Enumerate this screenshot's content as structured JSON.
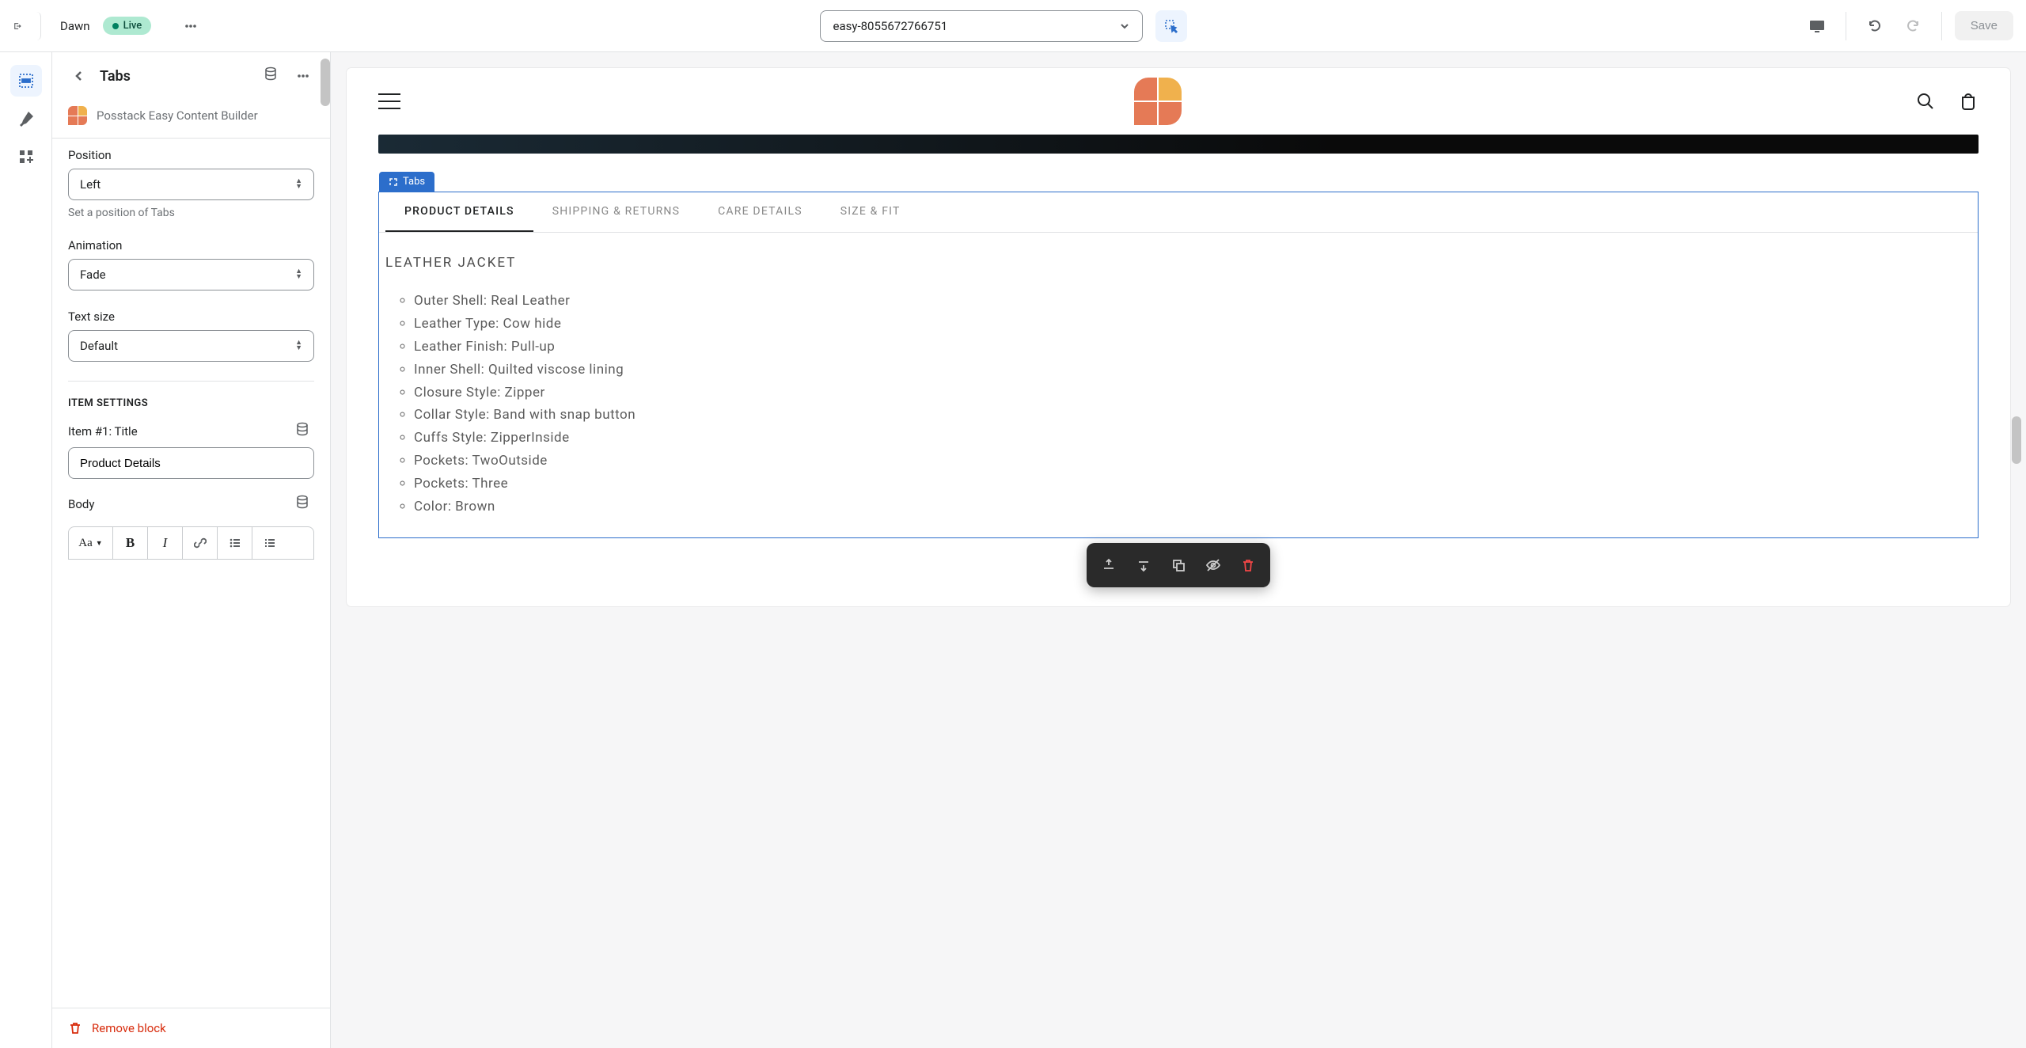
{
  "topbar": {
    "theme_name": "Dawn",
    "live_label": "Live",
    "page_select_value": "easy-8055672766751",
    "save_label": "Save"
  },
  "sidebar": {
    "title": "Tabs",
    "app_name": "Posstack Easy Content Builder",
    "position": {
      "label": "Position",
      "value": "Left",
      "help": "Set a position of Tabs"
    },
    "animation": {
      "label": "Animation",
      "value": "Fade"
    },
    "text_size": {
      "label": "Text size",
      "value": "Default"
    },
    "item_settings_heading": "ITEM SETTINGS",
    "item1_title": {
      "label": "Item #1: Title",
      "value": "Product Details"
    },
    "body_label": "Body",
    "remove_label": "Remove block"
  },
  "preview": {
    "tabs_block_label": "Tabs",
    "tabs": [
      "PRODUCT DETAILS",
      "SHIPPING & RETURNS",
      "CARE DETAILS",
      "SIZE & FIT"
    ],
    "content_heading": "LEATHER JACKET",
    "details": [
      "Outer Shell: Real Leather",
      "Leather Type: Cow hide",
      "Leather Finish: Pull-up",
      "Inner Shell: Quilted viscose lining",
      "Closure Style: Zipper",
      "Collar Style: Band with snap button",
      "Cuffs Style: ZipperInside",
      "Pockets: TwoOutside",
      "Pockets: Three",
      "Color: Brown"
    ]
  }
}
